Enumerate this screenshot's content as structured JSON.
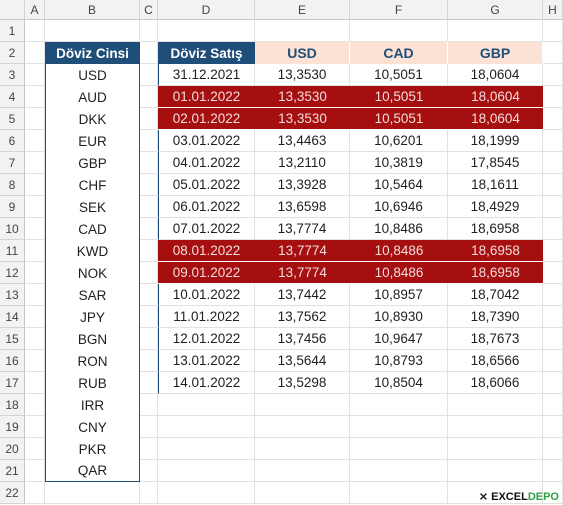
{
  "columns": [
    "A",
    "B",
    "C",
    "D",
    "E",
    "F",
    "G",
    "H"
  ],
  "rows": [
    "1",
    "2",
    "3",
    "4",
    "5",
    "6",
    "7",
    "8",
    "9",
    "10",
    "11",
    "12",
    "13",
    "14",
    "15",
    "16",
    "17",
    "18",
    "19",
    "20",
    "21",
    "22"
  ],
  "currency_list": {
    "header": "Döviz Cinsi",
    "items": [
      "USD",
      "AUD",
      "DKK",
      "EUR",
      "GBP",
      "CHF",
      "SEK",
      "CAD",
      "KWD",
      "NOK",
      "SAR",
      "JPY",
      "BGN",
      "RON",
      "RUB",
      "IRR",
      "CNY",
      "PKR",
      "QAR"
    ]
  },
  "rates_table": {
    "headers": [
      "Döviz Satış",
      "USD",
      "CAD",
      "GBP"
    ],
    "rows": [
      {
        "date": "31.12.2021",
        "usd": "13,3530",
        "cad": "10,5051",
        "gbp": "18,0604",
        "highlighted": false
      },
      {
        "date": "01.01.2022",
        "usd": "13,3530",
        "cad": "10,5051",
        "gbp": "18,0604",
        "highlighted": true
      },
      {
        "date": "02.01.2022",
        "usd": "13,3530",
        "cad": "10,5051",
        "gbp": "18,0604",
        "highlighted": true
      },
      {
        "date": "03.01.2022",
        "usd": "13,4463",
        "cad": "10,6201",
        "gbp": "18,1999",
        "highlighted": false
      },
      {
        "date": "04.01.2022",
        "usd": "13,2110",
        "cad": "10,3819",
        "gbp": "17,8545",
        "highlighted": false
      },
      {
        "date": "05.01.2022",
        "usd": "13,3928",
        "cad": "10,5464",
        "gbp": "18,1611",
        "highlighted": false
      },
      {
        "date": "06.01.2022",
        "usd": "13,6598",
        "cad": "10,6946",
        "gbp": "18,4929",
        "highlighted": false
      },
      {
        "date": "07.01.2022",
        "usd": "13,7774",
        "cad": "10,8486",
        "gbp": "18,6958",
        "highlighted": false
      },
      {
        "date": "08.01.2022",
        "usd": "13,7774",
        "cad": "10,8486",
        "gbp": "18,6958",
        "highlighted": true
      },
      {
        "date": "09.01.2022",
        "usd": "13,7774",
        "cad": "10,8486",
        "gbp": "18,6958",
        "highlighted": true
      },
      {
        "date": "10.01.2022",
        "usd": "13,7442",
        "cad": "10,8957",
        "gbp": "18,7042",
        "highlighted": false
      },
      {
        "date": "11.01.2022",
        "usd": "13,7562",
        "cad": "10,8930",
        "gbp": "18,7390",
        "highlighted": false
      },
      {
        "date": "12.01.2022",
        "usd": "13,7456",
        "cad": "10,9647",
        "gbp": "18,7673",
        "highlighted": false
      },
      {
        "date": "13.01.2022",
        "usd": "13,5644",
        "cad": "10,8793",
        "gbp": "18,6566",
        "highlighted": false
      },
      {
        "date": "14.01.2022",
        "usd": "13,5298",
        "cad": "10,8504",
        "gbp": "18,6066",
        "highlighted": false
      }
    ]
  },
  "colors": {
    "header_dark": "#1f4e78",
    "header_peach": "#fbe2d5",
    "highlight": "#a50f0f"
  },
  "watermark": {
    "part1": "EXCEL",
    "part2": "DEPO"
  }
}
